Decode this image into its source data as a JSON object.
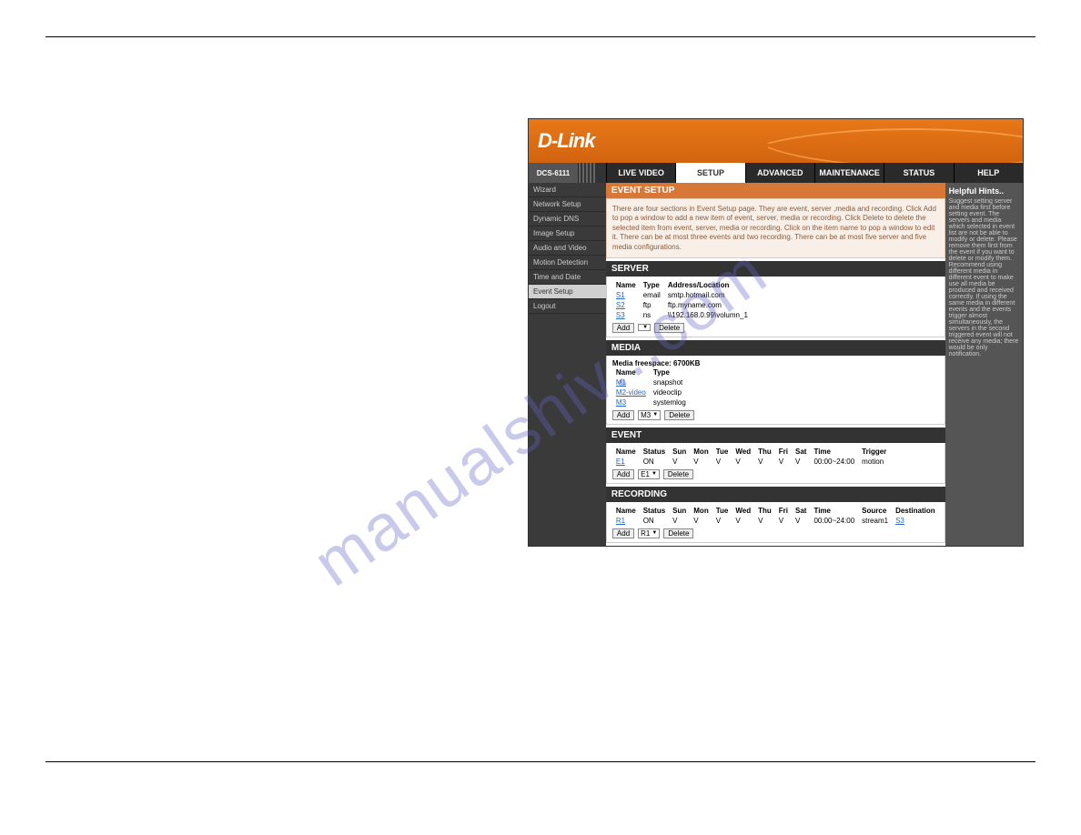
{
  "watermark": "manualshiv...com",
  "logo": "D-Link",
  "model": "DCS-6111",
  "nav": {
    "live_video": "LIVE VIDEO",
    "setup": "SETUP",
    "advanced": "ADVANCED",
    "maintenance": "MAINTENANCE",
    "status": "STATUS",
    "help": "HELP"
  },
  "sidebar": {
    "items": [
      "Wizard",
      "Network Setup",
      "Dynamic DNS",
      "Image Setup",
      "Audio and Video",
      "Motion Detection",
      "Time and Date",
      "Event Setup",
      "Logout"
    ],
    "active_index": 7
  },
  "event_setup": {
    "title": "EVENT SETUP",
    "intro": "There are four sections in Event Setup page. They are event, server ,media and recording. Click Add to pop a window to add a new item of event, server, media or recording. Click Delete to delete the selected item from event, server, media or recording. Click on the item name to pop a window to edit it. There can be at most three events and two recording. There can be at most five server and five media configurations."
  },
  "server": {
    "title": "SERVER",
    "headers": [
      "Name",
      "Type",
      "Address/Location"
    ],
    "rows": [
      {
        "name": "S1",
        "type": "email",
        "addr": "smtp.hotmail.com"
      },
      {
        "name": "S2",
        "type": "ftp",
        "addr": "ftp.myname.com"
      },
      {
        "name": "S3",
        "type": "ns",
        "addr": "\\\\192.168.0.99\\volumn_1"
      }
    ],
    "add": "Add",
    "delete": "Delete"
  },
  "media": {
    "title": "MEDIA",
    "freespace_label": "Media freespace: 6700KB",
    "headers": [
      "Name",
      "Type"
    ],
    "rows": [
      {
        "name": "M1",
        "type": "snapshot"
      },
      {
        "name": "M2-video",
        "type": "videoclip"
      },
      {
        "name": "M3",
        "type": "systemlog"
      }
    ],
    "add": "Add",
    "select": "M3",
    "delete": "Delete"
  },
  "event": {
    "title": "EVENT",
    "headers": [
      "Name",
      "Status",
      "Sun",
      "Mon",
      "Tue",
      "Wed",
      "Thu",
      "Fri",
      "Sat",
      "Time",
      "Trigger"
    ],
    "rows": [
      {
        "name": "E1",
        "status": "ON",
        "sun": "V",
        "mon": "V",
        "tue": "V",
        "wed": "V",
        "thu": "V",
        "fri": "V",
        "sat": "V",
        "time": "00:00~24:00",
        "trigger": "motion"
      }
    ],
    "add": "Add",
    "select": "E1",
    "delete": "Delete"
  },
  "recording": {
    "title": "RECORDING",
    "headers": [
      "Name",
      "Status",
      "Sun",
      "Mon",
      "Tue",
      "Wed",
      "Thu",
      "Fri",
      "Sat",
      "Time",
      "Source",
      "Destination"
    ],
    "rows": [
      {
        "name": "R1",
        "status": "ON",
        "sun": "V",
        "mon": "V",
        "tue": "V",
        "wed": "V",
        "thu": "V",
        "fri": "V",
        "sat": "V",
        "time": "00:00~24:00",
        "source": "stream1",
        "dest": "S3"
      }
    ],
    "add": "Add",
    "select": "R1",
    "delete": "Delete"
  },
  "hints": {
    "title": "Helpful Hints..",
    "body": "Suggest setting server and media first before setting event. The servers and media which selected in event list are not be able to modify or delete. Please remove them first from the event if you want to delete or modify them. Recommend using different media in different event to make use all media be produced and received correctly. If using the same media in different events and the events trigger almost simultaneously, the servers in the second triggered event will not receive any media; there would be only notification."
  }
}
